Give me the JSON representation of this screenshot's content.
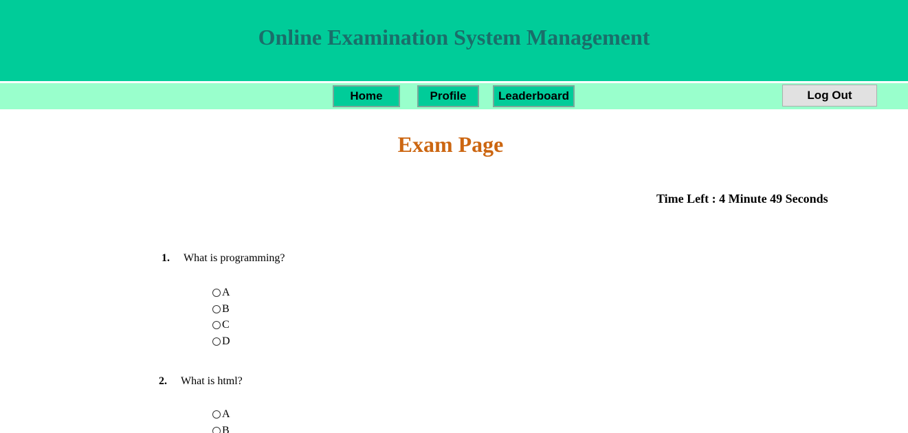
{
  "header": {
    "title": "Online Examination System Management"
  },
  "nav": {
    "home": "Home",
    "profile": "Profile",
    "leaderboard": "Leaderboard",
    "logout": "Log Out"
  },
  "page_title": "Exam Page",
  "timer": "Time Left : 4 Minute 49 Seconds",
  "questions": [
    {
      "number": "1.",
      "text": "What is programming?",
      "options": [
        "A",
        "B",
        "C",
        "D"
      ]
    },
    {
      "number": "2.",
      "text": "What is html?",
      "options": [
        "A",
        "B"
      ]
    }
  ],
  "colors": {
    "header_bg": "#00cc99",
    "nav_bg": "#99ffcc",
    "title": "#1a6e6a",
    "page_title": "#cc6611"
  }
}
